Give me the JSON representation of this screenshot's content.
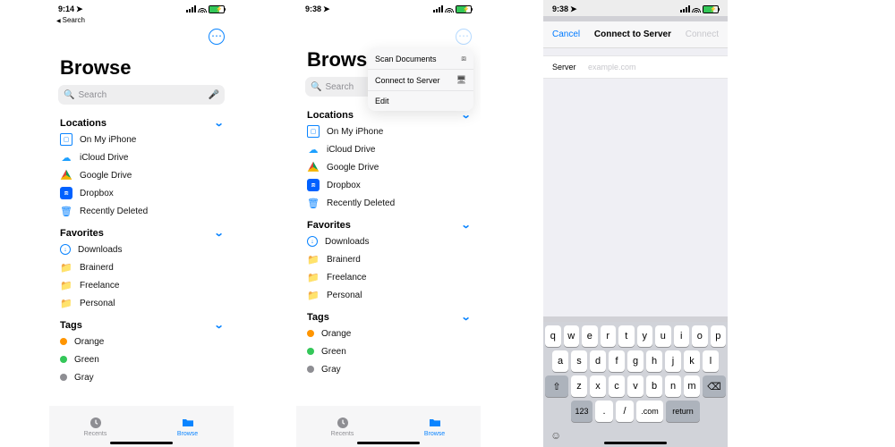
{
  "screen1": {
    "time": "9:14",
    "back": "Search",
    "title": "Browse",
    "searchPlaceholder": "Search",
    "sections": {
      "locations": {
        "header": "Locations",
        "items": [
          "On My iPhone",
          "iCloud Drive",
          "Google Drive",
          "Dropbox",
          "Recently Deleted"
        ]
      },
      "favorites": {
        "header": "Favorites",
        "items": [
          "Downloads",
          "Brainerd",
          "Freelance",
          "Personal"
        ]
      },
      "tags": {
        "header": "Tags",
        "items": [
          {
            "label": "Orange",
            "color": "#ff9500"
          },
          {
            "label": "Green",
            "color": "#34c759"
          },
          {
            "label": "Gray",
            "color": "#8e8e93"
          }
        ]
      }
    },
    "tabs": {
      "recents": "Recents",
      "browse": "Browse"
    }
  },
  "screen2": {
    "time": "9:38",
    "title": "Browse",
    "searchPlaceholder": "Search",
    "menu": [
      "Scan Documents",
      "Connect to Server",
      "Edit"
    ],
    "sections_same_as_screen1": true
  },
  "screen3": {
    "time": "9:38",
    "nav": {
      "cancel": "Cancel",
      "title": "Connect to Server",
      "connect": "Connect"
    },
    "form": {
      "label": "Server",
      "placeholder": "example.com"
    },
    "keyboard": {
      "row1": [
        "q",
        "w",
        "e",
        "r",
        "t",
        "y",
        "u",
        "i",
        "o",
        "p"
      ],
      "row2": [
        "a",
        "s",
        "d",
        "f",
        "g",
        "h",
        "j",
        "k",
        "l"
      ],
      "row3": [
        "z",
        "x",
        "c",
        "v",
        "b",
        "n",
        "m"
      ],
      "row4": {
        "num": "123",
        "punct": [
          ".",
          "/"
        ],
        "com": ".com",
        "ret": "return"
      }
    }
  }
}
